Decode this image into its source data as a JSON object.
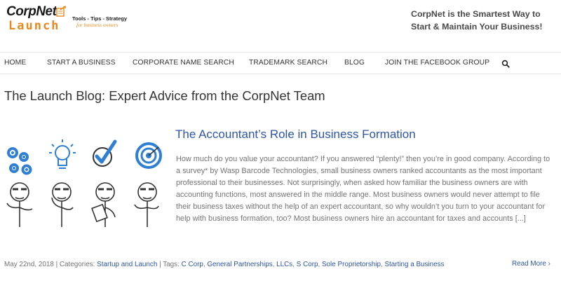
{
  "header": {
    "logo": {
      "word_top": "CorpNet",
      "word_bottom": "Launch"
    },
    "tagline": {
      "main": "Tools - Tips - Strategy",
      "sub": "for business owners"
    },
    "slogan": "CorpNet is the Smartest Way to Start & Maintain Your Business!"
  },
  "nav": {
    "items": [
      {
        "label": "HOME"
      },
      {
        "label": "START A BUSINESS"
      },
      {
        "label": "CORPORATE NAME SEARCH"
      },
      {
        "label": "TRADEMARK SEARCH"
      },
      {
        "label": "BLOG"
      },
      {
        "label": "JOIN THE FACEBOOK GROUP"
      }
    ],
    "search_icon": "search-icon"
  },
  "page": {
    "title": "The Launch Blog: Expert Advice from the CorpNet Team"
  },
  "post": {
    "title": "The Accountant’s Role in Business Formation",
    "excerpt": "How much do you value your accountant? If you answered “plenty!” then you’re in good company. According to a survey* by Wasp Barcode Technologies, small business owners ranked accountants as the most important professional to their businesses. Not surprisingly, when asked how familiar the business owners are with accounting functions, most answered in the middle range. Most business owners would never attempt to file their business taxes without the help of an expert accountant, so why wouldn’t you turn to your accountant for help with business formation, too? Most business owners hire an accountant for taxes and accounts [...]",
    "image_icons": [
      "gears-icon",
      "lightbulb-icon",
      "checkmark-icon",
      "target-icon"
    ],
    "meta": {
      "date": "May 22nd, 2018",
      "sep1": " | ",
      "categories_label": "Categories: ",
      "category": "Startup and Launch",
      "sep2": " | ",
      "tags_label": "Tags: ",
      "tags": [
        "C Corp",
        "General Partnerships",
        "LLCs",
        "S Corp",
        "Sole Proprietorship",
        "Starting a Business"
      ],
      "tag_separator": ", "
    },
    "read_more": "Read More ›"
  },
  "colors": {
    "brand_orange": "#e8891e",
    "link_blue": "#2e55a8",
    "illustration_blue": "#2f7fd4",
    "text_gray": "#747474"
  }
}
